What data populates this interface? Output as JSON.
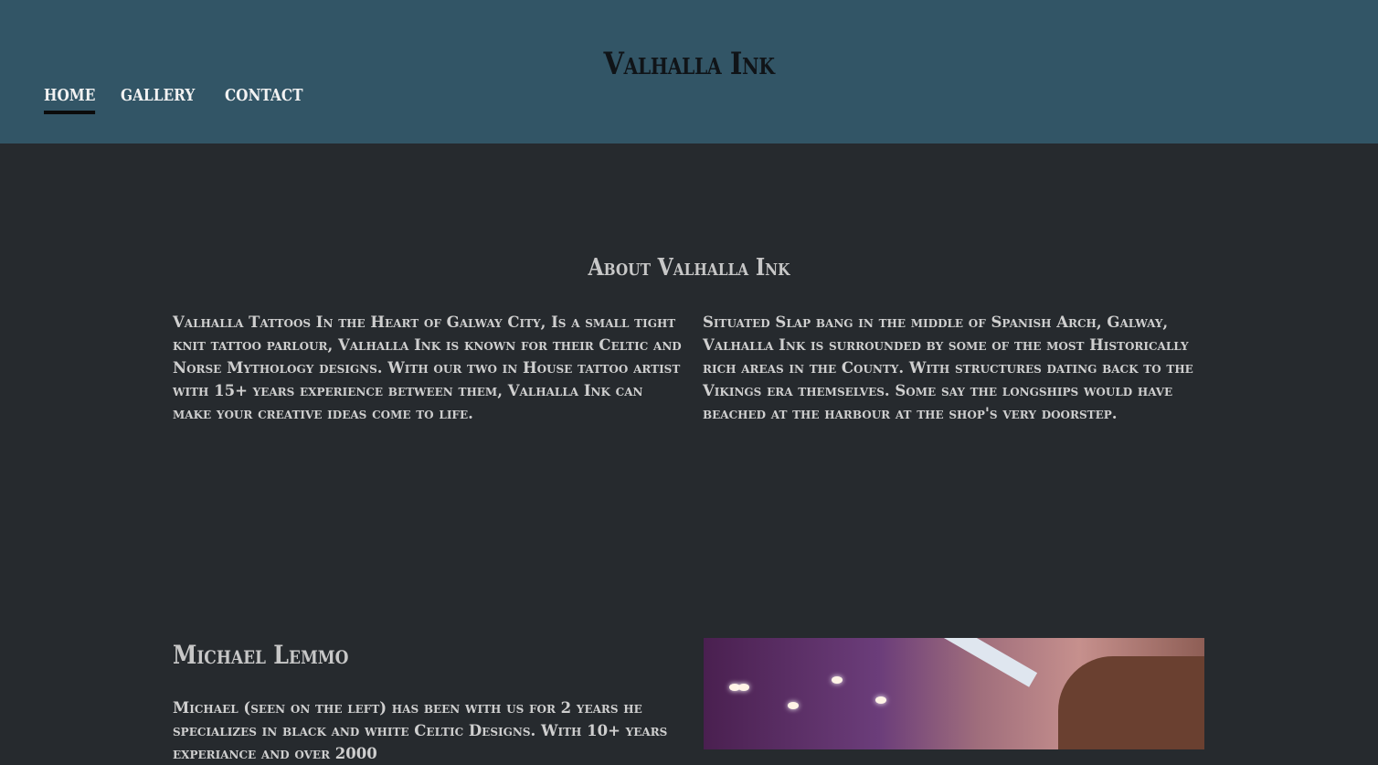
{
  "header": {
    "title": "Valhalla Ink",
    "nav": [
      {
        "label": "HOME",
        "active": true
      },
      {
        "label": "GALLERY",
        "active": false
      },
      {
        "label": "CONTACT",
        "active": false
      }
    ],
    "bg_color": "#325566"
  },
  "about": {
    "title": "About Valhalla Ink",
    "left_text": "Valhalla Tattoos In the Heart of Galway City, Is a small tight knit tattoo parlour, Valhalla Ink is known for their Celtic and Norse Mythology designs. With our two in House tattoo artist with 15+ years experience between them, Valhalla Ink can make your creative ideas come to life.",
    "right_text": "Situated Slap bang in the middle of Spanish Arch, Galway, Valhalla Ink is surrounded by some of the most Historically rich areas in the County. With structures dating back to the Vikings era themselves. Some say the longships would have beached at the harbour at the shop's very doorstep."
  },
  "artist": {
    "name": "Michael Lemmo",
    "bio": "Michael (seen on the left) has been with us for 2 years he specializes in black and white Celtic Designs. With 10+ years experiance and over 2000"
  },
  "colors": {
    "page_bg": "#262a2e",
    "title_color": "#101418"
  }
}
